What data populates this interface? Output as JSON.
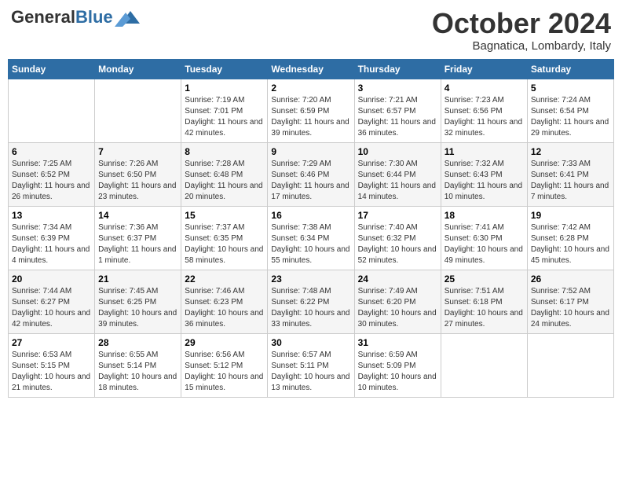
{
  "header": {
    "logo_general": "General",
    "logo_blue": "Blue",
    "month": "October 2024",
    "location": "Bagnatica, Lombardy, Italy"
  },
  "weekdays": [
    "Sunday",
    "Monday",
    "Tuesday",
    "Wednesday",
    "Thursday",
    "Friday",
    "Saturday"
  ],
  "weeks": [
    [
      {
        "day": "",
        "info": ""
      },
      {
        "day": "",
        "info": ""
      },
      {
        "day": "1",
        "info": "Sunrise: 7:19 AM\nSunset: 7:01 PM\nDaylight: 11 hours and 42 minutes."
      },
      {
        "day": "2",
        "info": "Sunrise: 7:20 AM\nSunset: 6:59 PM\nDaylight: 11 hours and 39 minutes."
      },
      {
        "day": "3",
        "info": "Sunrise: 7:21 AM\nSunset: 6:57 PM\nDaylight: 11 hours and 36 minutes."
      },
      {
        "day": "4",
        "info": "Sunrise: 7:23 AM\nSunset: 6:56 PM\nDaylight: 11 hours and 32 minutes."
      },
      {
        "day": "5",
        "info": "Sunrise: 7:24 AM\nSunset: 6:54 PM\nDaylight: 11 hours and 29 minutes."
      }
    ],
    [
      {
        "day": "6",
        "info": "Sunrise: 7:25 AM\nSunset: 6:52 PM\nDaylight: 11 hours and 26 minutes."
      },
      {
        "day": "7",
        "info": "Sunrise: 7:26 AM\nSunset: 6:50 PM\nDaylight: 11 hours and 23 minutes."
      },
      {
        "day": "8",
        "info": "Sunrise: 7:28 AM\nSunset: 6:48 PM\nDaylight: 11 hours and 20 minutes."
      },
      {
        "day": "9",
        "info": "Sunrise: 7:29 AM\nSunset: 6:46 PM\nDaylight: 11 hours and 17 minutes."
      },
      {
        "day": "10",
        "info": "Sunrise: 7:30 AM\nSunset: 6:44 PM\nDaylight: 11 hours and 14 minutes."
      },
      {
        "day": "11",
        "info": "Sunrise: 7:32 AM\nSunset: 6:43 PM\nDaylight: 11 hours and 10 minutes."
      },
      {
        "day": "12",
        "info": "Sunrise: 7:33 AM\nSunset: 6:41 PM\nDaylight: 11 hours and 7 minutes."
      }
    ],
    [
      {
        "day": "13",
        "info": "Sunrise: 7:34 AM\nSunset: 6:39 PM\nDaylight: 11 hours and 4 minutes."
      },
      {
        "day": "14",
        "info": "Sunrise: 7:36 AM\nSunset: 6:37 PM\nDaylight: 11 hours and 1 minute."
      },
      {
        "day": "15",
        "info": "Sunrise: 7:37 AM\nSunset: 6:35 PM\nDaylight: 10 hours and 58 minutes."
      },
      {
        "day": "16",
        "info": "Sunrise: 7:38 AM\nSunset: 6:34 PM\nDaylight: 10 hours and 55 minutes."
      },
      {
        "day": "17",
        "info": "Sunrise: 7:40 AM\nSunset: 6:32 PM\nDaylight: 10 hours and 52 minutes."
      },
      {
        "day": "18",
        "info": "Sunrise: 7:41 AM\nSunset: 6:30 PM\nDaylight: 10 hours and 49 minutes."
      },
      {
        "day": "19",
        "info": "Sunrise: 7:42 AM\nSunset: 6:28 PM\nDaylight: 10 hours and 45 minutes."
      }
    ],
    [
      {
        "day": "20",
        "info": "Sunrise: 7:44 AM\nSunset: 6:27 PM\nDaylight: 10 hours and 42 minutes."
      },
      {
        "day": "21",
        "info": "Sunrise: 7:45 AM\nSunset: 6:25 PM\nDaylight: 10 hours and 39 minutes."
      },
      {
        "day": "22",
        "info": "Sunrise: 7:46 AM\nSunset: 6:23 PM\nDaylight: 10 hours and 36 minutes."
      },
      {
        "day": "23",
        "info": "Sunrise: 7:48 AM\nSunset: 6:22 PM\nDaylight: 10 hours and 33 minutes."
      },
      {
        "day": "24",
        "info": "Sunrise: 7:49 AM\nSunset: 6:20 PM\nDaylight: 10 hours and 30 minutes."
      },
      {
        "day": "25",
        "info": "Sunrise: 7:51 AM\nSunset: 6:18 PM\nDaylight: 10 hours and 27 minutes."
      },
      {
        "day": "26",
        "info": "Sunrise: 7:52 AM\nSunset: 6:17 PM\nDaylight: 10 hours and 24 minutes."
      }
    ],
    [
      {
        "day": "27",
        "info": "Sunrise: 6:53 AM\nSunset: 5:15 PM\nDaylight: 10 hours and 21 minutes."
      },
      {
        "day": "28",
        "info": "Sunrise: 6:55 AM\nSunset: 5:14 PM\nDaylight: 10 hours and 18 minutes."
      },
      {
        "day": "29",
        "info": "Sunrise: 6:56 AM\nSunset: 5:12 PM\nDaylight: 10 hours and 15 minutes."
      },
      {
        "day": "30",
        "info": "Sunrise: 6:57 AM\nSunset: 5:11 PM\nDaylight: 10 hours and 13 minutes."
      },
      {
        "day": "31",
        "info": "Sunrise: 6:59 AM\nSunset: 5:09 PM\nDaylight: 10 hours and 10 minutes."
      },
      {
        "day": "",
        "info": ""
      },
      {
        "day": "",
        "info": ""
      }
    ]
  ]
}
